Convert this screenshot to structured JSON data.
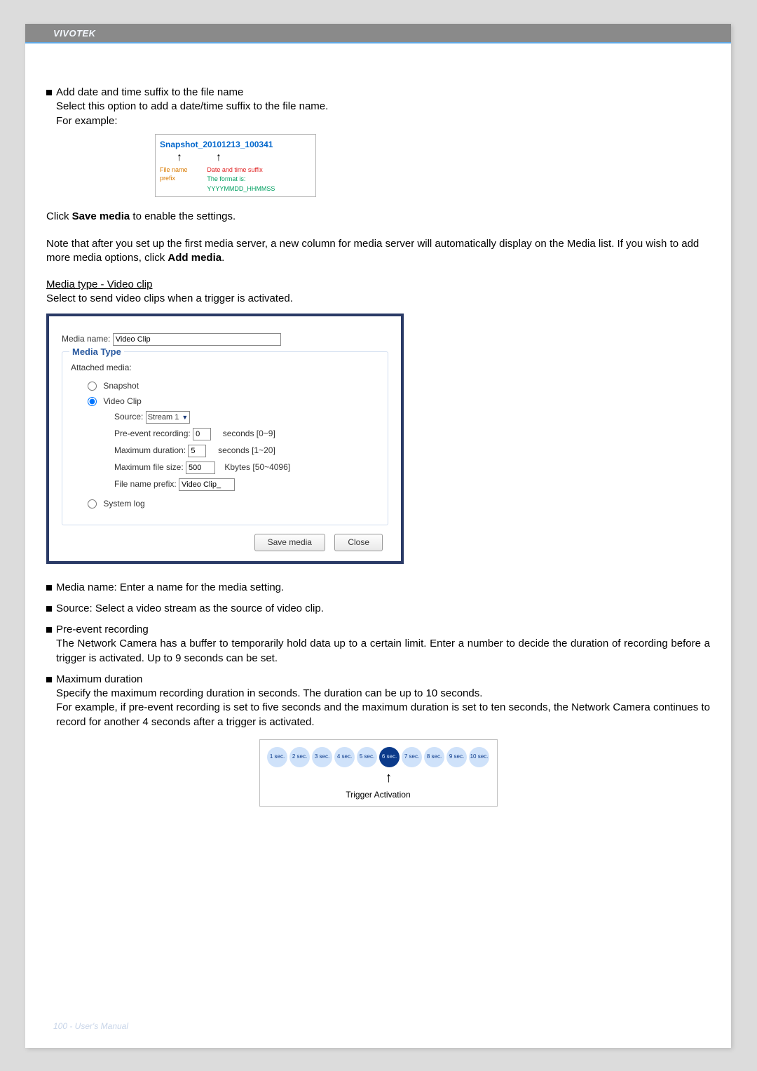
{
  "brand": "VIVOTEK",
  "section1": {
    "title": "Add date and time suffix to the file name",
    "line2": "Select this option to add a date/time suffix to the file name.",
    "line3": "For example:"
  },
  "fig1": {
    "snapshot_prefix": "Snapshot",
    "snapshot_suffix": "_20101213_100341",
    "file_name_prefix": "File name prefix",
    "date_time_suffix": "Date and time suffix",
    "format": "The format is: YYYYMMDD_HHMMSS"
  },
  "save_line_pre": "Click ",
  "save_line_bold": "Save media",
  "save_line_post": " to enable the settings.",
  "note_line_pre": "Note that after you set up the first media server, a new column for media server will automatically display on the Media list.  If you wish to add more media options, click ",
  "note_line_bold": "Add media",
  "note_line_post": ".",
  "video_heading": "Media type - Video clip",
  "video_desc": "Select to send video clips when a trigger is activated.",
  "dialog": {
    "media_name_label": "Media name:",
    "media_name_value": "Video Clip",
    "legend": "Media Type",
    "attached": "Attached media:",
    "opt_snapshot": "Snapshot",
    "opt_videoclip": "Video Clip",
    "opt_systemlog": "System log",
    "source_label": "Source:",
    "source_value": "Stream 1",
    "pre_label": "Pre-event recording:",
    "pre_value": "0",
    "pre_hint": "seconds [0~9]",
    "maxdur_label": "Maximum duration:",
    "maxdur_value": "5",
    "maxdur_hint": "seconds [1~20]",
    "maxfs_label": "Maximum file size:",
    "maxfs_value": "500",
    "maxfs_hint": "Kbytes [50~4096]",
    "fnp_label": "File name prefix:",
    "fnp_value": "Video Clip_",
    "btn_save": "Save media",
    "btn_close": "Close"
  },
  "desc": {
    "d1": "Media name: Enter a name for the media setting.",
    "d2": "Source: Select a video stream as the source of video clip.",
    "d3_title": "Pre-event recording",
    "d3_body": "The Network Camera has a buffer to temporarily hold data up to a certain limit. Enter a number to decide the duration of recording before a trigger is activated. Up to 9 seconds can be set.",
    "d4_title": "Maximum duration",
    "d4_l1": "Specify the maximum recording duration in seconds. The duration can be up to 10 seconds.",
    "d4_l2": "For example, if pre-event recording is set to five seconds and the maximum duration is set to ten seconds, the Network Camera continues to record for another 4 seconds after a trigger is activated."
  },
  "fig2": {
    "secs": [
      "1 sec.",
      "2 sec.",
      "3 sec.",
      "4 sec.",
      "5 sec.",
      "6 sec.",
      "7 sec.",
      "8 sec.",
      "9 sec.",
      "10 sec."
    ],
    "trigger": "Trigger Activation"
  },
  "footer": "100 - User's Manual"
}
